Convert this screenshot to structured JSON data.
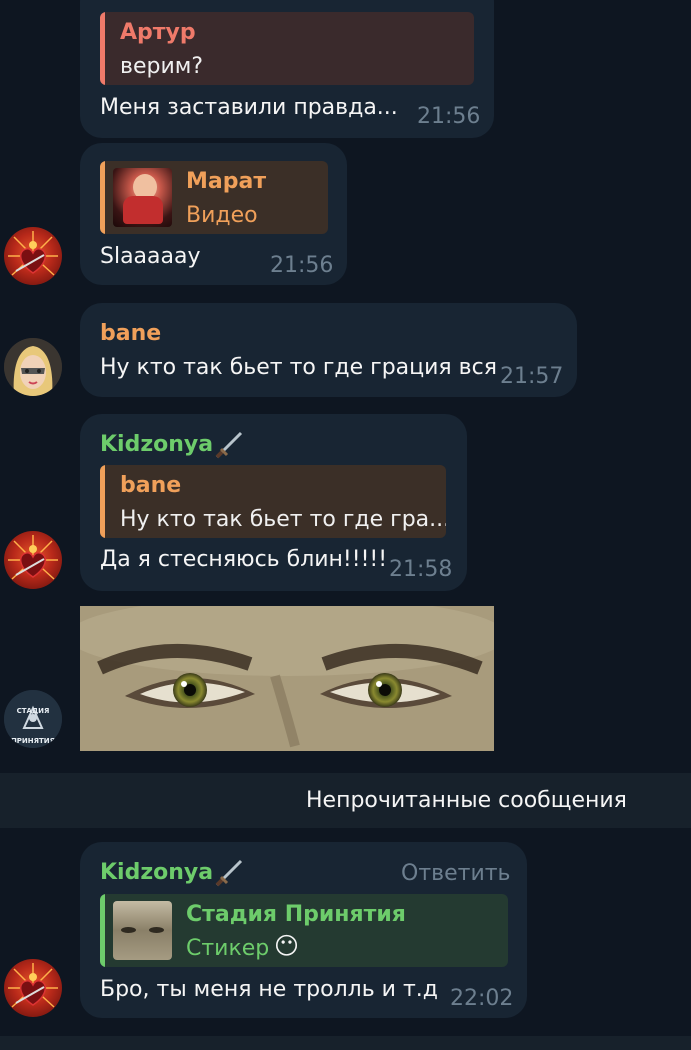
{
  "colors": {
    "background": "#0e1621",
    "bubble": "#182533",
    "time": "#6d7f8f",
    "green_name": "#6dcc6b",
    "orange_name": "#f0a05a",
    "red_name": "#ef7a6a"
  },
  "messages": [
    {
      "reply_name": "Артур",
      "reply_text": "верим?",
      "text": "Меня заставили правда...",
      "time": "21:56"
    },
    {
      "reply_name": "Марат",
      "reply_text": "Видео",
      "text": "Slaaaaay",
      "time": "21:56"
    },
    {
      "sender": "bane",
      "text": "Ну кто так бьет то где грация вся",
      "time": "21:57"
    },
    {
      "sender": "Kidzonya",
      "reply_name": "bane",
      "reply_text": "Ну кто так бьет то где гра...",
      "text": "Да я стесняюсь блин!!!!!",
      "time": "21:58"
    },
    {
      "sender": "Kidzonya",
      "action": "Ответить",
      "reply_name": "Стадия Принятия",
      "reply_text": "Стикер",
      "reply_emoji": "😶",
      "text": "Бро, ты меня не тролль и т.д",
      "time": "22:02"
    }
  ],
  "avatar_label": "СТАДИЯ ПРИНЯТИЯ",
  "unread_divider": "Непрочитанные сообщения"
}
